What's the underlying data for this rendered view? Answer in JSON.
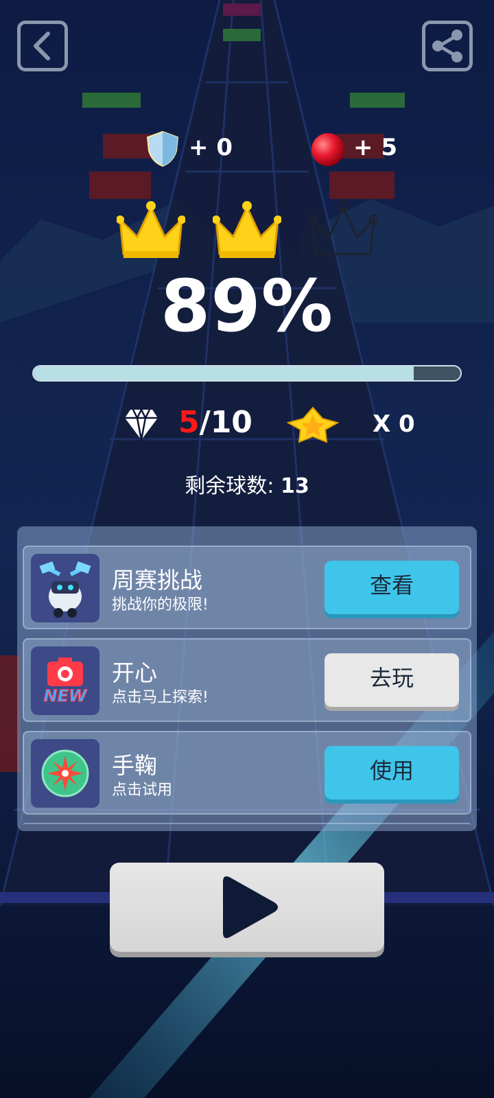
{
  "stats": {
    "shield_value": "+ 0",
    "ball_value": "+ 5"
  },
  "crowns": {
    "earned": 2,
    "total": 3
  },
  "progress": {
    "percent_text": "89%",
    "fraction": 0.89
  },
  "gems": {
    "collected": "5",
    "total": "/10"
  },
  "stars": {
    "count_text": "X 0"
  },
  "balls_remaining": {
    "label": "剩余球数: ",
    "value": "13"
  },
  "cards": [
    {
      "title": "周赛挑战",
      "subtitle": "挑战你的极限!",
      "button": "查看",
      "button_style": "blue",
      "icon": "robot-character-icon"
    },
    {
      "title": "开心",
      "subtitle": "点击马上探索!",
      "button": "去玩",
      "button_style": "gray",
      "icon": "new-game-icon"
    },
    {
      "title": "手鞠",
      "subtitle": "点击试用",
      "button": "使用",
      "button_style": "blue",
      "icon": "temari-ball-icon"
    }
  ],
  "icon_labels": {
    "new_badge": "NEW"
  },
  "colors": {
    "gems_collected": "#ff1a1a",
    "button_blue": "#3fc4ea",
    "button_gray": "#e8e8e8",
    "crown_gold": "#ffd21a"
  }
}
